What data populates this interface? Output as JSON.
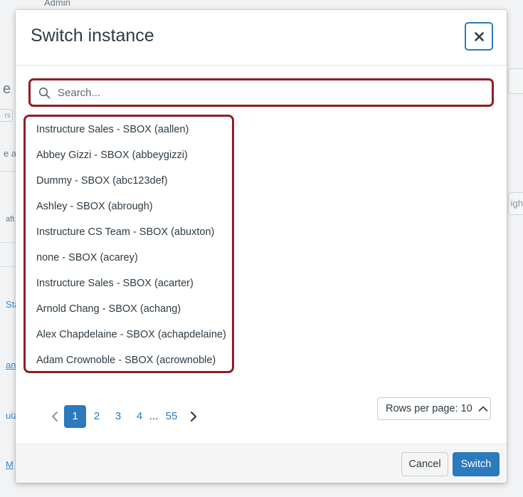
{
  "background": {
    "top_fragment": "Admin",
    "left_fragments": [
      "e",
      "rs",
      "e a",
      "aft",
      "Sta",
      "an",
      "uiz",
      "M"
    ],
    "right_fragment": "igh"
  },
  "modal": {
    "title": "Switch instance",
    "close_icon": "close-icon",
    "search": {
      "placeholder": "Search...",
      "value": "",
      "icon": "search-icon"
    },
    "instances": [
      "Instructure Sales - SBOX (aallen)",
      "Abbey Gizzi - SBOX (abbeygizzi)",
      "Dummy - SBOX (abc123def)",
      "Ashley - SBOX (abrough)",
      "Instructure CS Team - SBOX (abuxton)",
      "none - SBOX (acarey)",
      "Instructure Sales - SBOX (acarter)",
      "Arnold Chang - SBOX (achang)",
      "Alex Chapdelaine - SBOX (achapdelaine)",
      "Adam Crownoble - SBOX (acrownoble)"
    ],
    "pagination": {
      "prev_icon": "chevron-left-icon",
      "pages": [
        "1",
        "2",
        "3",
        "4"
      ],
      "current_page": "1",
      "ellipsis": "...",
      "last_page": "55",
      "next_icon": "chevron-right-icon"
    },
    "rows_per_page": {
      "label": "Rows per page: 10",
      "icon": "chevron-up-icon"
    },
    "footer": {
      "cancel_label": "Cancel",
      "switch_label": "Switch"
    }
  },
  "colors": {
    "accent": "#2b7abc",
    "highlight_border": "#8f1d26",
    "text": "#2d3b45",
    "footer_bg": "#f5f5f5"
  }
}
